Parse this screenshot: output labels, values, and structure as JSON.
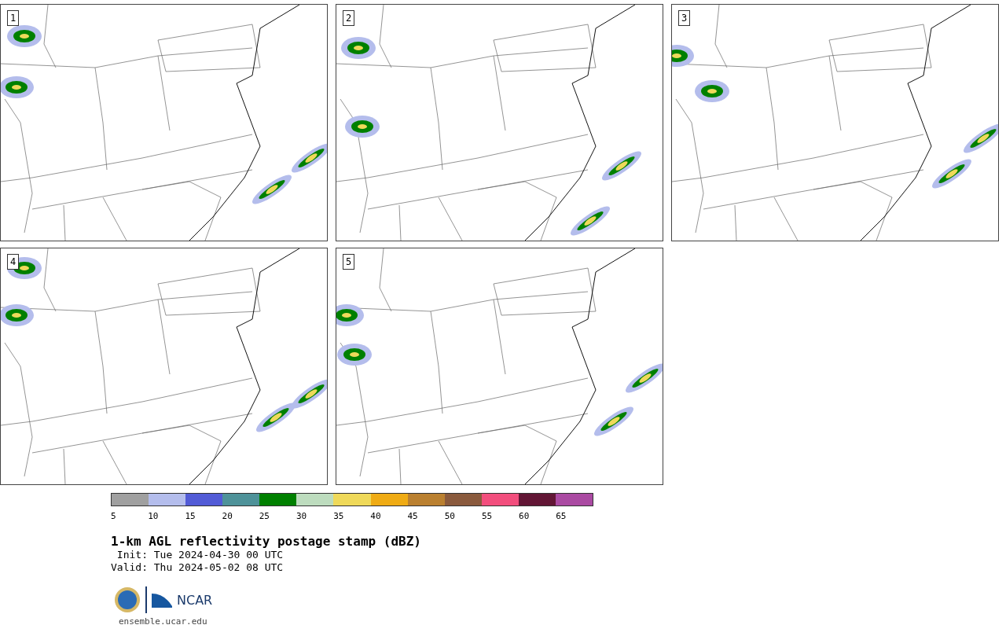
{
  "panels": [
    {
      "label": "1"
    },
    {
      "label": "2"
    },
    {
      "label": "3"
    },
    {
      "label": "4"
    },
    {
      "label": "5"
    }
  ],
  "colorbar": {
    "bins": [
      {
        "color": "#a0a0a0"
      },
      {
        "color": "#b4bdec"
      },
      {
        "color": "#525bd6"
      },
      {
        "color": "#4e9299"
      },
      {
        "color": "#008000"
      },
      {
        "color": "#bddcbe"
      },
      {
        "color": "#efd95a"
      },
      {
        "color": "#efab14"
      },
      {
        "color": "#ba8030"
      },
      {
        "color": "#8a5a3d"
      },
      {
        "color": "#f24e7d"
      },
      {
        "color": "#621635"
      },
      {
        "color": "#aa4aa2"
      }
    ],
    "ticks": [
      "5",
      "10",
      "15",
      "20",
      "25",
      "30",
      "35",
      "40",
      "45",
      "50",
      "55",
      "60",
      "65"
    ]
  },
  "title": "1-km AGL reflectivity postage stamp (dBZ)",
  "init": " Init: Tue 2024-04-30 00 UTC",
  "valid": "Valid: Thu 2024-05-02 08 UTC",
  "logo": {
    "text": "NCAR"
  },
  "url": "ensemble.ucar.edu"
}
